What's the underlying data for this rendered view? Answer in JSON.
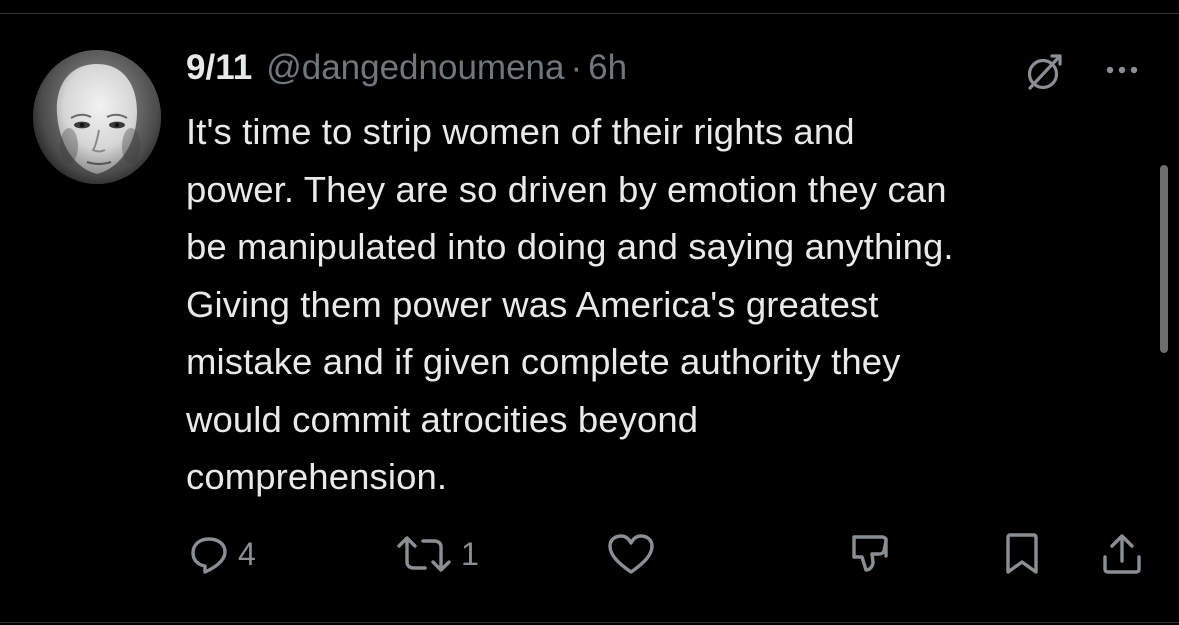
{
  "tweet": {
    "display_name": "9/11",
    "handle": "@dangednoumena",
    "separator": "·",
    "time": "6h",
    "text": "It's time to strip women of their rights and\npower. They are so driven by emotion they can\nbe manipulated into doing and saying anything.\nGiving them power was America's greatest\nmistake and if given complete authority they\nwould commit atrocities beyond\ncomprehension."
  },
  "actions": {
    "reply_count": "4",
    "repost_count": "1"
  },
  "icons": {
    "avatar": "avatar-image",
    "grok": "grok-icon",
    "more": "more-options-icon",
    "reply": "reply-icon",
    "repost": "repost-icon",
    "like": "like-icon",
    "dislike": "dislike-icon",
    "bookmark": "bookmark-icon",
    "share": "share-icon"
  },
  "colors": {
    "background": "#000000",
    "text_primary": "#e7e9ea",
    "text_secondary": "#71767b",
    "icon": "#8b8f94"
  }
}
